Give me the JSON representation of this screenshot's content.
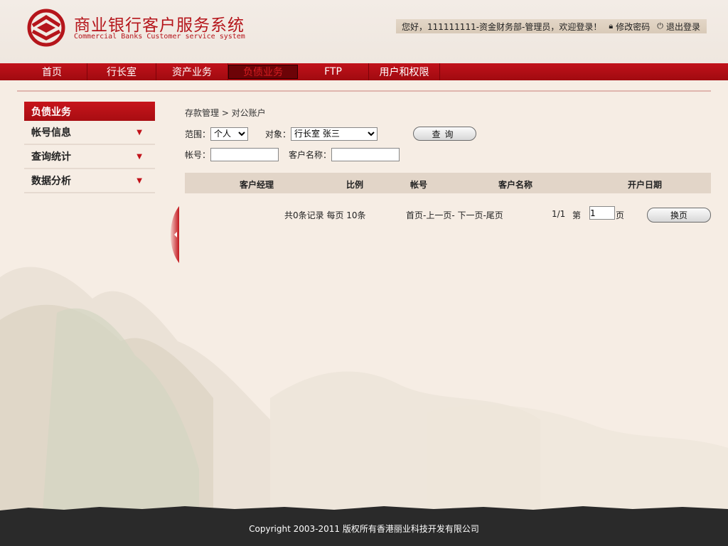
{
  "header": {
    "title_cn": "商业银行客户服务系统",
    "title_en": "Commercial Banks Customer service system",
    "greeting": "您好，111111111-资金财务部-管理员，欢迎登录！",
    "change_password": "修改密码",
    "logout": "退出登录"
  },
  "nav": {
    "items": [
      {
        "label": "首页"
      },
      {
        "label": "行长室"
      },
      {
        "label": "资产业务"
      },
      {
        "label": "负债业务"
      },
      {
        "label": "FTP"
      },
      {
        "label": "用户和权限"
      }
    ],
    "active": "负债业务"
  },
  "sidebar": {
    "title": "负债业务",
    "items": [
      {
        "label": "帐号信息"
      },
      {
        "label": "查询统计"
      },
      {
        "label": "数据分析"
      }
    ]
  },
  "breadcrumb": "存款管理 > 对公账户",
  "filters": {
    "scope_label": "范围：",
    "scope_value": "个人",
    "target_label": "对象：",
    "target_value": "行长室 张三",
    "query_button": "查询",
    "account_label": "帐号：",
    "account_value": "",
    "customer_name_label": "客户名称：",
    "customer_name_value": ""
  },
  "table": {
    "columns": [
      "客户经理",
      "比例",
      "帐号",
      "客户名称",
      "开户日期"
    ],
    "rows": []
  },
  "pager": {
    "summary": "共0条记录 每页 10条",
    "links": "首页-上一页- 下一页-尾页",
    "position": "1/1",
    "page_prefix": "第",
    "page_value": "1",
    "page_suffix": "页",
    "change_button": "换页"
  },
  "footer": {
    "copyright": "Copyright 2003-2011 版权所有香港丽业科技开发有限公司"
  },
  "colors": {
    "brand_red": "#b5151b",
    "nav_red": "#c1121a",
    "background": "#f6ede4",
    "footer": "#2a2a2a"
  }
}
